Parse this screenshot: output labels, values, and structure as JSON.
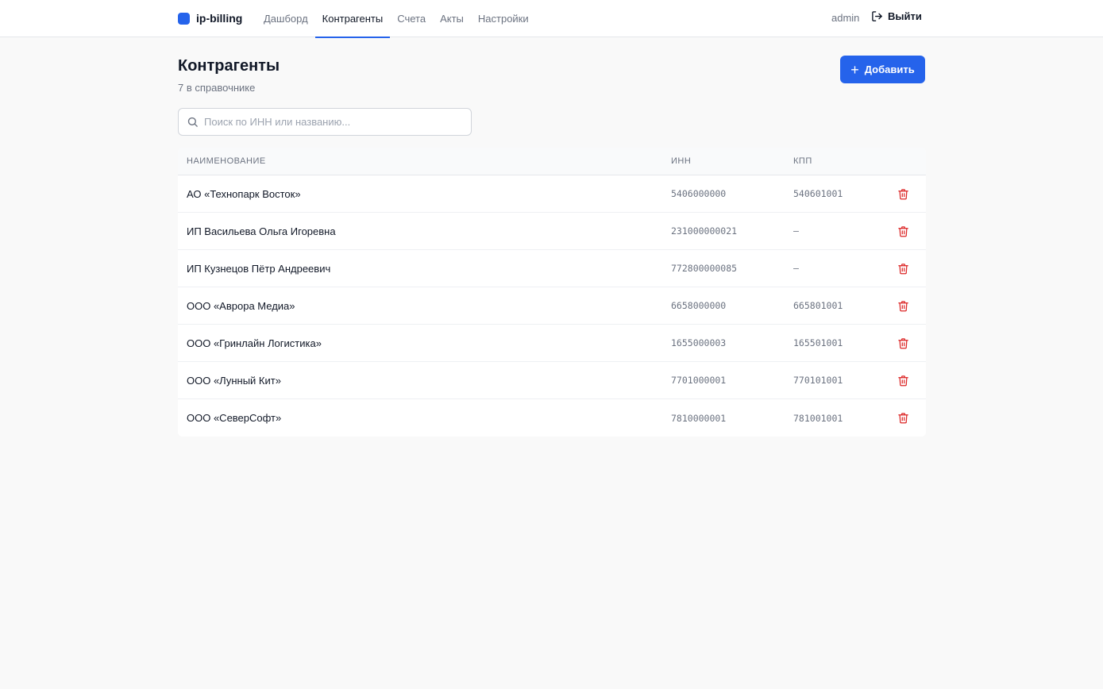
{
  "app": {
    "name": "ip-billing"
  },
  "nav": [
    {
      "label": "Дашборд",
      "active": false
    },
    {
      "label": "Контрагенты",
      "active": true
    },
    {
      "label": "Счета",
      "active": false
    },
    {
      "label": "Акты",
      "active": false
    },
    {
      "label": "Настройки",
      "active": false
    }
  ],
  "user": {
    "name": "admin",
    "logout_label": "Выйти"
  },
  "page": {
    "title": "Контрагенты",
    "subtitle": "7 в справочнике",
    "add_label": "Добавить"
  },
  "search": {
    "placeholder": "Поиск по ИНН или названию...",
    "value": ""
  },
  "table": {
    "headers": {
      "name": "НАИМЕНОВАНИЕ",
      "inn": "ИНН",
      "kpp": "КПП"
    },
    "rows": [
      {
        "name": "АО «Технопарк Восток»",
        "inn": "5406000000",
        "kpp": "540601001"
      },
      {
        "name": "ИП Васильева Ольга Игоревна",
        "inn": "231000000021",
        "kpp": "—"
      },
      {
        "name": "ИП Кузнецов Пётр Андреевич",
        "inn": "772800000085",
        "kpp": "—"
      },
      {
        "name": "ООО «Аврора Медиа»",
        "inn": "6658000000",
        "kpp": "665801001"
      },
      {
        "name": "ООО «Гринлайн Логистика»",
        "inn": "1655000003",
        "kpp": "165501001"
      },
      {
        "name": "ООО «Лунный Кит»",
        "inn": "7701000001",
        "kpp": "770101001"
      },
      {
        "name": "ООО «СеверСофт»",
        "inn": "7810000001",
        "kpp": "781001001"
      }
    ]
  },
  "colors": {
    "accent": "#2563eb",
    "danger": "#dc2626"
  },
  "icons": {
    "search": "search-icon",
    "logout": "logout-icon",
    "plus": "plus-icon",
    "delete": "trash-icon"
  }
}
